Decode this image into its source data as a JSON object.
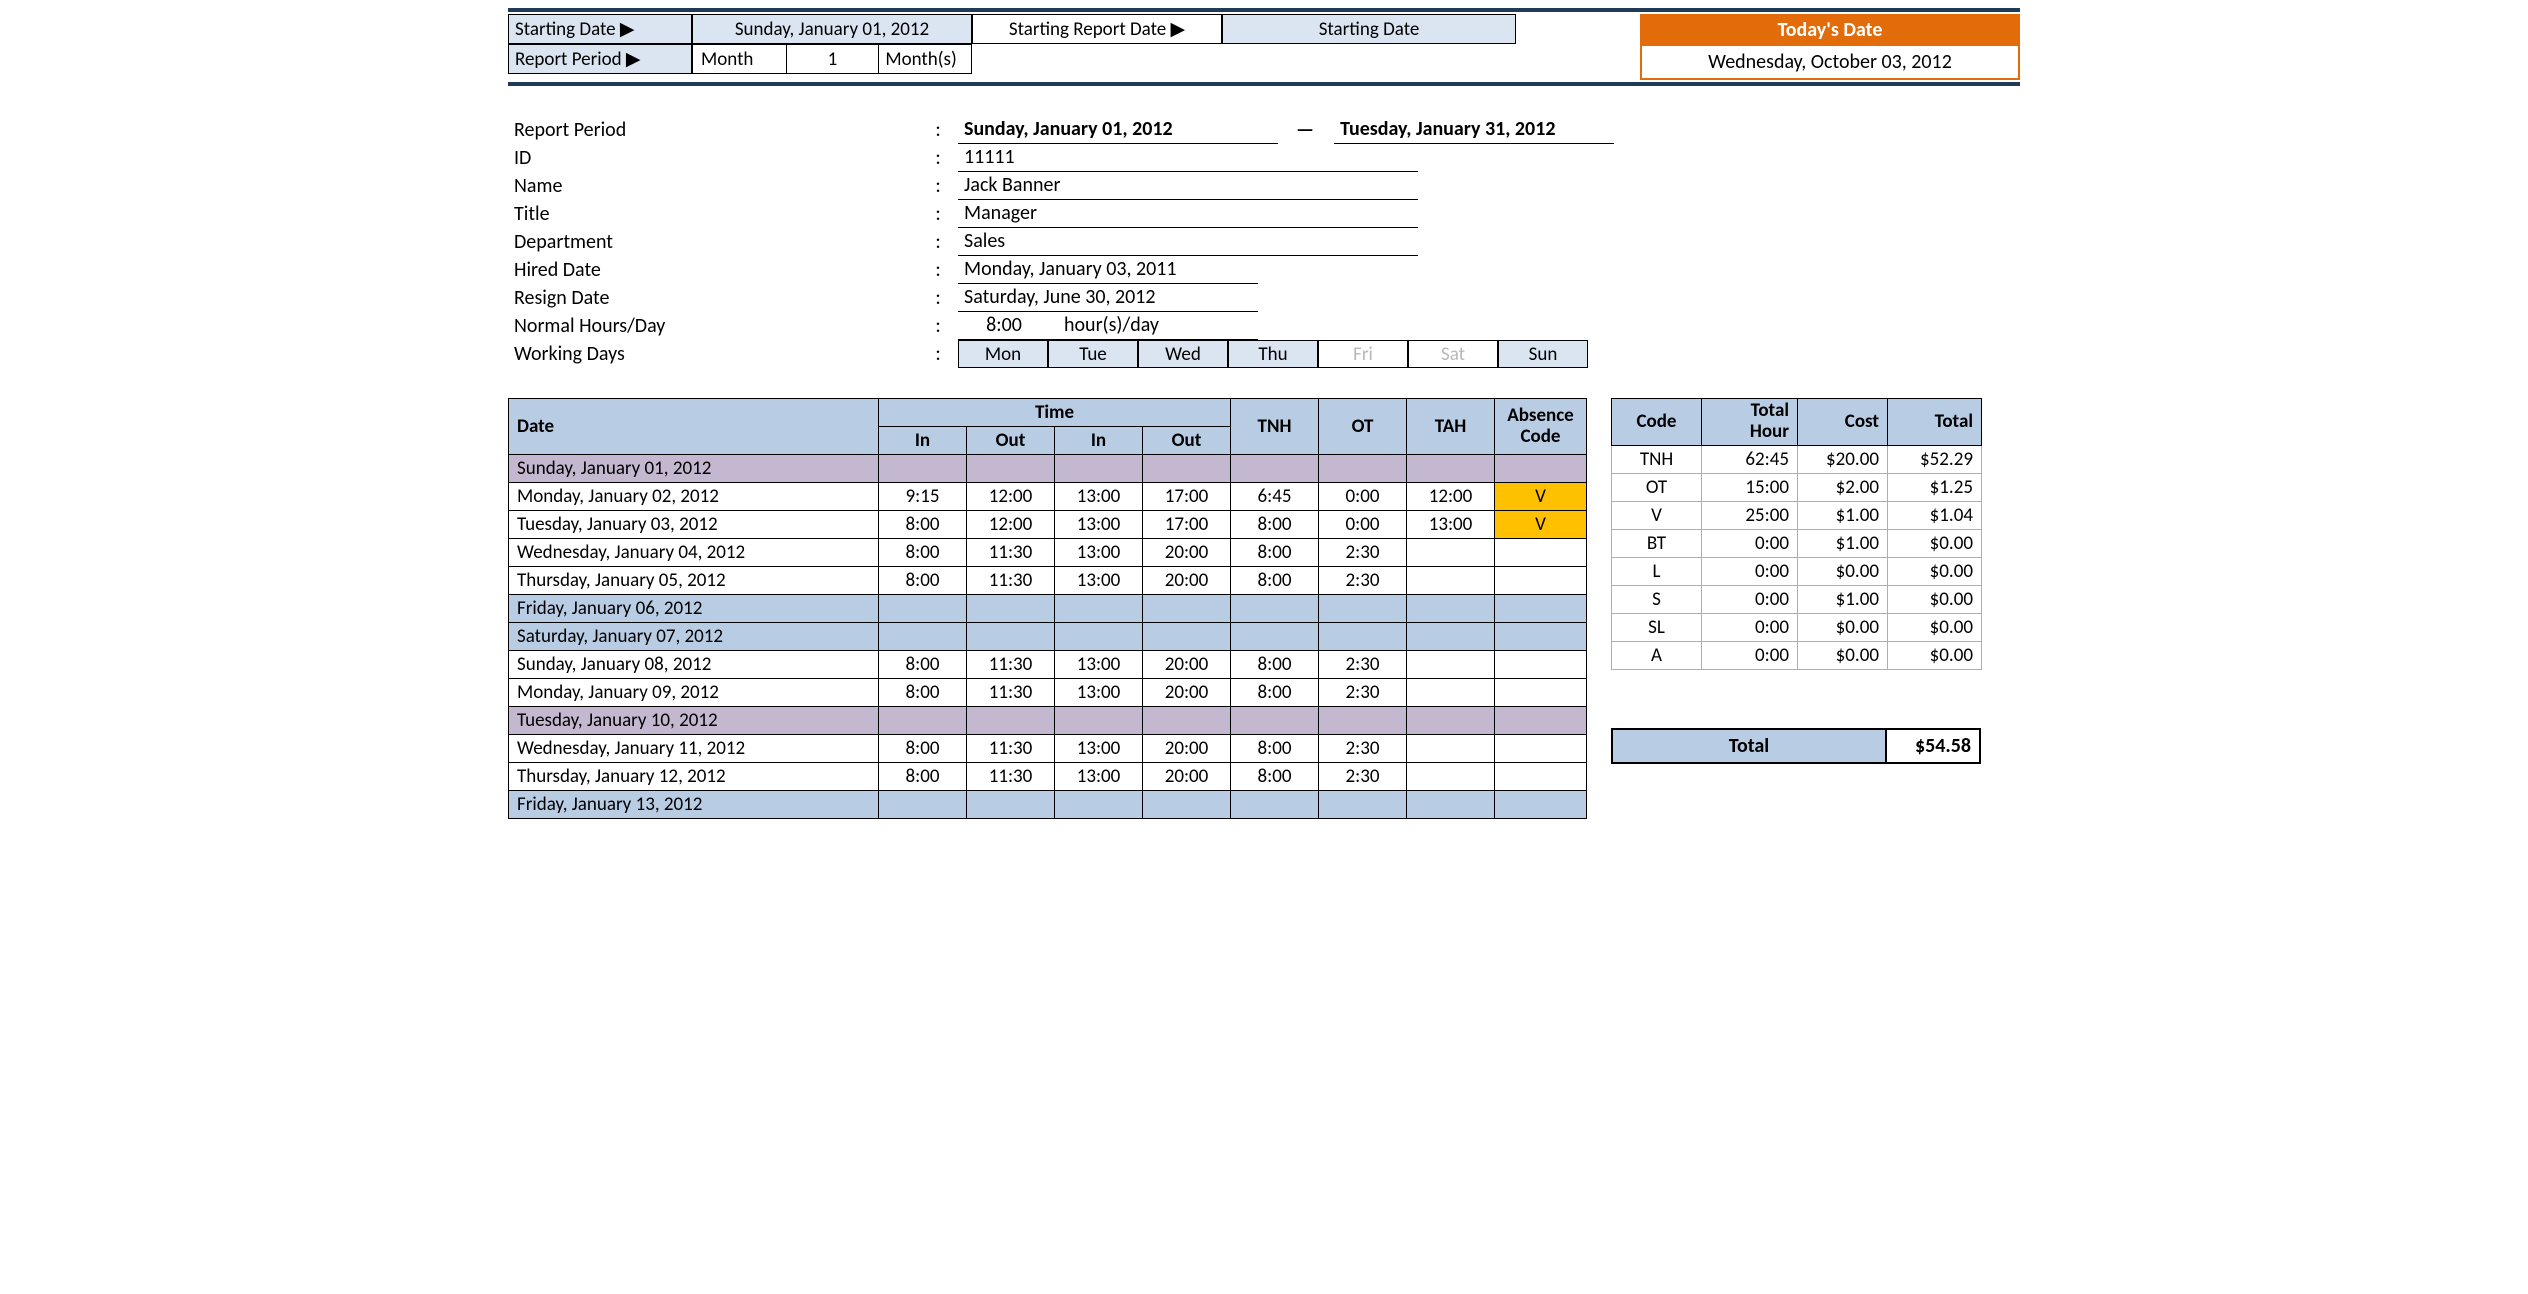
{
  "topbar": {
    "starting_date_label": "Starting Date ▶",
    "starting_date_value": "Sunday, January 01, 2012",
    "starting_report_label": "Starting Report Date ▶",
    "starting_report_value": "Starting Date",
    "report_period_label": "Report Period ▶",
    "report_period_unit": "Month",
    "report_period_qty": "1",
    "report_period_suffix": "Month(s)"
  },
  "today": {
    "label": "Today's Date",
    "value": "Wednesday, October 03, 2012"
  },
  "info": {
    "report_period_label": "Report Period",
    "report_period_from": "Sunday, January 01, 2012",
    "report_period_to": "Tuesday, January 31, 2012",
    "id_label": "ID",
    "id_value": "11111",
    "name_label": "Name",
    "name_value": "Jack Banner",
    "title_label": "Title",
    "title_value": "Manager",
    "dept_label": "Department",
    "dept_value": "Sales",
    "hired_label": "Hired Date",
    "hired_value": "Monday, January 03, 2011",
    "resign_label": "Resign Date",
    "resign_value": "Saturday, June 30, 2012",
    "normal_label": "Normal Hours/Day",
    "normal_value": "8:00",
    "normal_unit": "hour(s)/day",
    "working_label": "Working Days"
  },
  "days": [
    "Mon",
    "Tue",
    "Wed",
    "Thu",
    "Fri",
    "Sat",
    "Sun"
  ],
  "days_off": [
    false,
    false,
    false,
    false,
    true,
    true,
    false
  ],
  "table": {
    "headers": {
      "date": "Date",
      "time": "Time",
      "in1": "In",
      "out1": "Out",
      "in2": "In",
      "out2": "Out",
      "tnh": "TNH",
      "ot": "OT",
      "tah": "TAH",
      "abs": "Absence Code"
    },
    "rows": [
      {
        "date": "Sunday, January 01, 2012",
        "style": "purple"
      },
      {
        "date": "Monday, January 02, 2012",
        "in1": "9:15",
        "out1": "12:00",
        "in2": "13:00",
        "out2": "17:00",
        "tnh": "6:45",
        "ot": "0:00",
        "tah": "12:00",
        "abs": "V",
        "absYellow": true
      },
      {
        "date": "Tuesday, January 03, 2012",
        "in1": "8:00",
        "out1": "12:00",
        "in2": "13:00",
        "out2": "17:00",
        "tnh": "8:00",
        "ot": "0:00",
        "tah": "13:00",
        "abs": "V",
        "absYellow": true
      },
      {
        "date": "Wednesday, January 04, 2012",
        "in1": "8:00",
        "out1": "11:30",
        "in2": "13:00",
        "out2": "20:00",
        "tnh": "8:00",
        "ot": "2:30"
      },
      {
        "date": "Thursday, January 05, 2012",
        "in1": "8:00",
        "out1": "11:30",
        "in2": "13:00",
        "out2": "20:00",
        "tnh": "8:00",
        "ot": "2:30"
      },
      {
        "date": "Friday, January 06, 2012",
        "style": "blue"
      },
      {
        "date": "Saturday, January 07, 2012",
        "style": "blue"
      },
      {
        "date": "Sunday, January 08, 2012",
        "in1": "8:00",
        "out1": "11:30",
        "in2": "13:00",
        "out2": "20:00",
        "tnh": "8:00",
        "ot": "2:30"
      },
      {
        "date": "Monday, January 09, 2012",
        "in1": "8:00",
        "out1": "11:30",
        "in2": "13:00",
        "out2": "20:00",
        "tnh": "8:00",
        "ot": "2:30"
      },
      {
        "date": "Tuesday, January 10, 2012",
        "style": "purple"
      },
      {
        "date": "Wednesday, January 11, 2012",
        "in1": "8:00",
        "out1": "11:30",
        "in2": "13:00",
        "out2": "20:00",
        "tnh": "8:00",
        "ot": "2:30"
      },
      {
        "date": "Thursday, January 12, 2012",
        "in1": "8:00",
        "out1": "11:30",
        "in2": "13:00",
        "out2": "20:00",
        "tnh": "8:00",
        "ot": "2:30"
      },
      {
        "date": "Friday, January 13, 2012",
        "style": "blue"
      }
    ]
  },
  "summary": {
    "headers": {
      "code": "Code",
      "hour": "Total Hour",
      "cost": "Cost",
      "total": "Total"
    },
    "rows": [
      {
        "code": "TNH",
        "hour": "62:45",
        "cost": "$20.00",
        "total": "$52.29"
      },
      {
        "code": "OT",
        "hour": "15:00",
        "cost": "$2.00",
        "total": "$1.25"
      },
      {
        "code": "V",
        "hour": "25:00",
        "cost": "$1.00",
        "total": "$1.04"
      },
      {
        "code": "BT",
        "hour": "0:00",
        "cost": "$1.00",
        "total": "$0.00"
      },
      {
        "code": "L",
        "hour": "0:00",
        "cost": "$0.00",
        "total": "$0.00"
      },
      {
        "code": "S",
        "hour": "0:00",
        "cost": "$1.00",
        "total": "$0.00"
      },
      {
        "code": "SL",
        "hour": "0:00",
        "cost": "$0.00",
        "total": "$0.00"
      },
      {
        "code": "A",
        "hour": "0:00",
        "cost": "$0.00",
        "total": "$0.00"
      }
    ]
  },
  "grand": {
    "label": "Total",
    "value": "$54.58"
  }
}
